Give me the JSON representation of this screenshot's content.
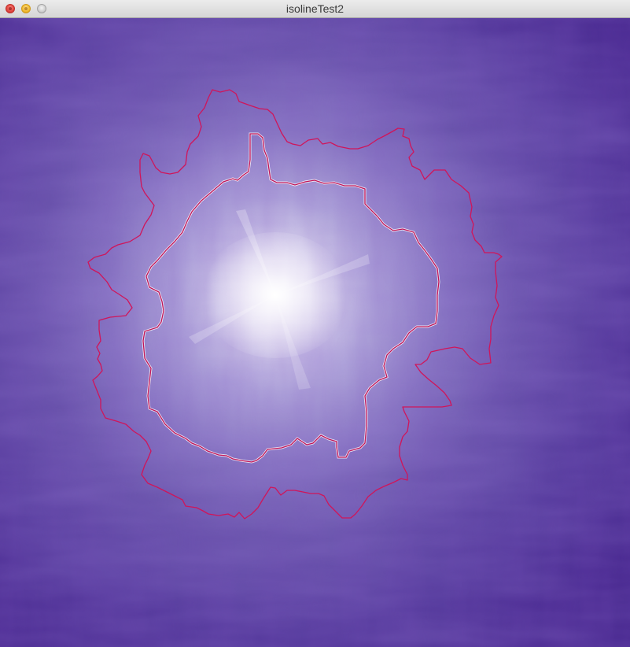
{
  "window": {
    "title": "isolineTest2"
  },
  "controls": {
    "close": "close-icon",
    "minimize": "minimize-icon",
    "zoom": "zoom-icon"
  },
  "colors": {
    "field_low": "#3c1787",
    "field_mid": "#6a55aa",
    "field_high": "#ffffff",
    "isoline_outer": "#d0155a",
    "isoline_inner": "#c01458"
  }
}
